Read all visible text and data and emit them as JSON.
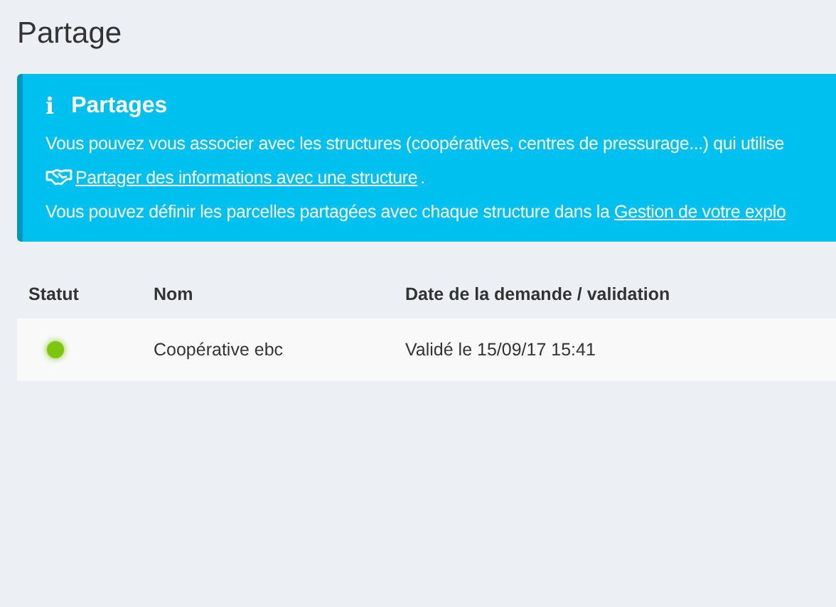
{
  "page": {
    "title": "Partage"
  },
  "info_panel": {
    "icon_text": "i",
    "title": "Partages",
    "paragraphs": [
      {
        "kind": "text",
        "text": "Vous pouvez vous associer avec les structures (coopératives, centres de pressurage...) qui utilise"
      },
      {
        "kind": "link",
        "link": "Partager des informations avec une structure",
        "after": "."
      },
      {
        "kind": "text_link",
        "text": "Vous pouvez définir les parcelles partagées avec chaque structure dans la ",
        "link": "Gestion de votre explo"
      }
    ]
  },
  "table": {
    "columns": [
      "Statut",
      "Nom",
      "Date de la demande / validation"
    ],
    "rows": [
      {
        "color": "#7cc70e",
        "name": "Coopérative ebc",
        "date": "Validé le 15/09/17 15:41"
      }
    ]
  }
}
